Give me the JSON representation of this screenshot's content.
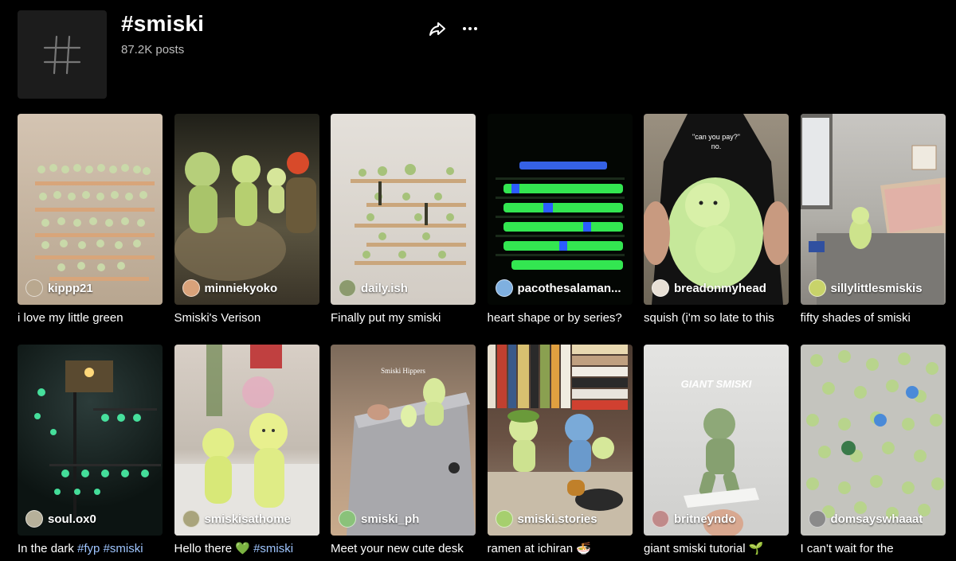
{
  "header": {
    "title": "#smiski",
    "posts": "87.2K posts",
    "hashtag_icon": "hashtag-icon",
    "share_icon": "share-icon",
    "more_icon": "more-icon"
  },
  "videos": [
    {
      "author": "kippp21",
      "caption": "i love my little green",
      "bg": "#c7b8a6",
      "avatar": "#b9a88f"
    },
    {
      "author": "minniekyoko",
      "caption": "Smiski's Verison",
      "bg": "#3a3a2c",
      "avatar": "#d9a27a"
    },
    {
      "author": "daily.ish",
      "caption": "Finally put my smiski",
      "bg": "#ddd8d1",
      "avatar": "#8c9a6e"
    },
    {
      "author": "pacothesalaman...",
      "caption": "heart shape or by series?",
      "bg": "#050805",
      "avatar": "#7fb0e0"
    },
    {
      "author": "breadonmyhead",
      "caption": "squish (i'm so late to this",
      "bg": "#8a8070",
      "avatar": "#e8e0d6"
    },
    {
      "author": "sillylittlesmiskis",
      "caption": "fifty shades of smiski",
      "bg": "#a9a7a3",
      "avatar": "#c8d36a"
    },
    {
      "author": "soul.ox0",
      "caption_plain": "In the dark ",
      "caption_tags": "#fyp #smiski",
      "bg": "#0e1a18",
      "avatar": "#b6b09a"
    },
    {
      "author": "smiskisathome",
      "caption_plain": "Hello there 💚 ",
      "caption_tags": "#smiski",
      "bg": "#cfc6be",
      "avatar": "#a9a47c"
    },
    {
      "author": "smiski_ph",
      "caption": "Meet your new cute desk",
      "bg": "#b69a82",
      "avatar": "#8ac27a",
      "overlay": "Smiski Hippers"
    },
    {
      "author": "smiski.stories",
      "caption": "ramen at ichiran 🍜",
      "bg": "#6a4a3a",
      "avatar": "#a6cf6e"
    },
    {
      "author": "britneyndo",
      "caption": "giant smiski tutorial 🌱",
      "bg": "#d6d6d6",
      "avatar": "#c08a8a",
      "overlay": "GIANT SMISKI"
    },
    {
      "author": "domsayswhaaat",
      "caption": "I can't wait for the",
      "bg": "#bcbcb6",
      "avatar": "#8a8a8a"
    }
  ],
  "overlays": {
    "card4": "\"can you pay?\"",
    "card4b": "no."
  }
}
